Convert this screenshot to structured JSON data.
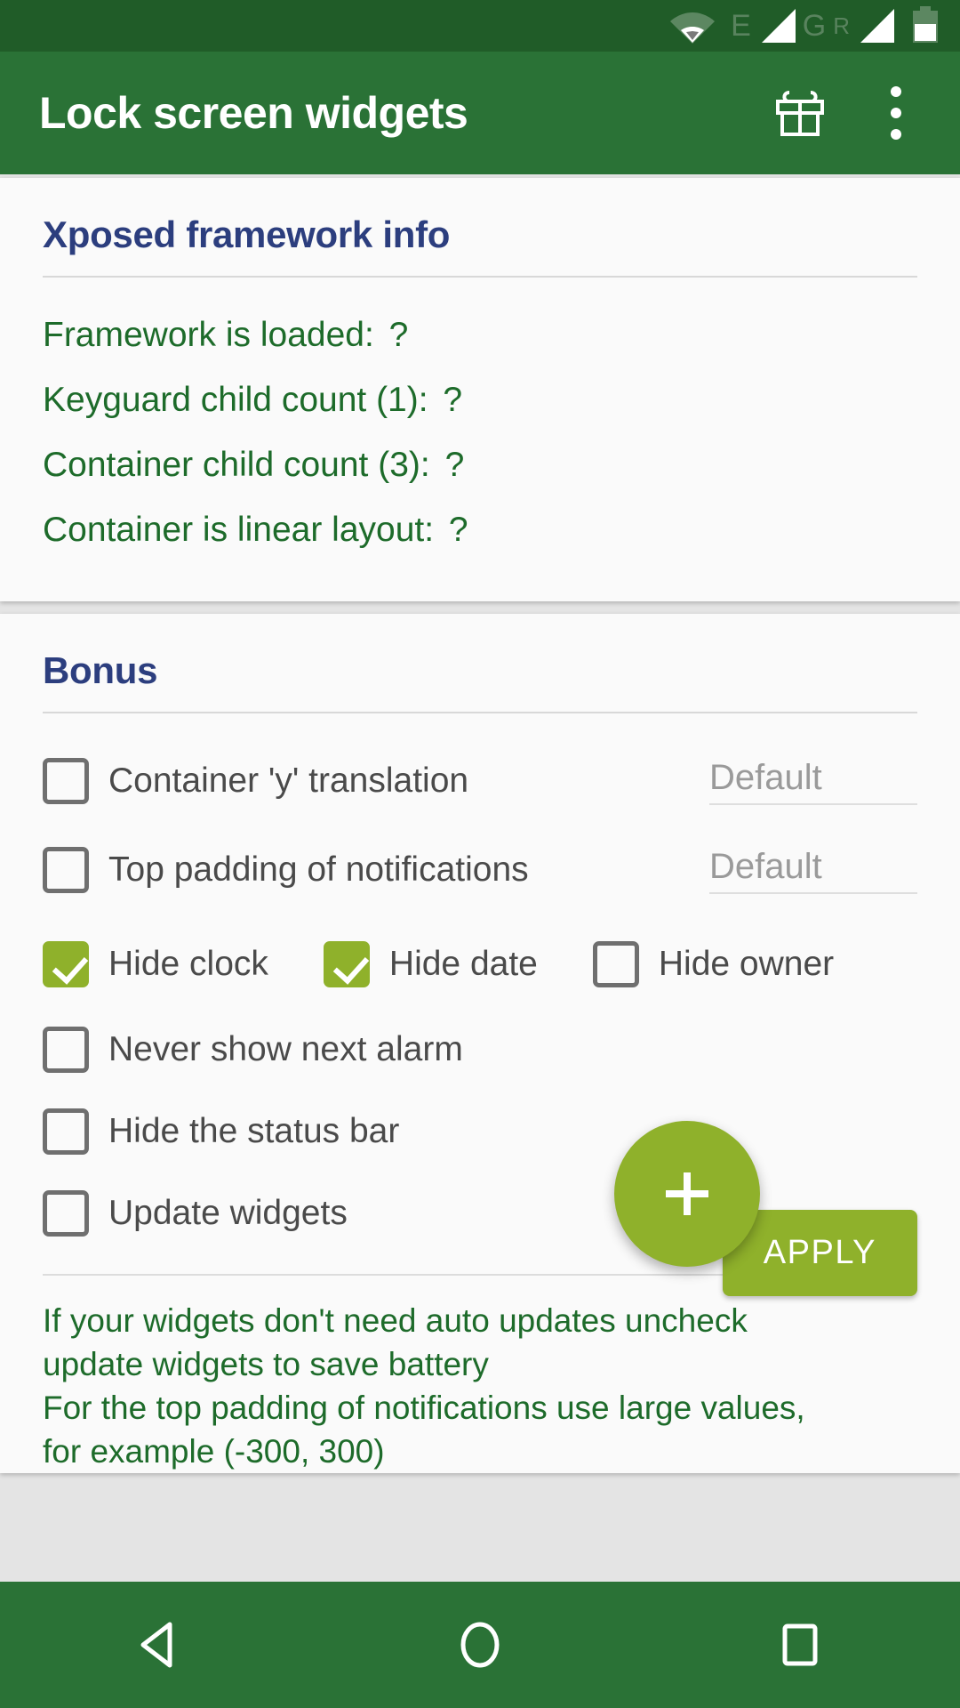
{
  "status_bar": {
    "icons": [
      {
        "name": "wifi-icon",
        "label": "wifi"
      },
      {
        "name": "network-type-edge-icon",
        "label": "E"
      },
      {
        "name": "signal-strength-sim1-icon",
        "label": "signal"
      },
      {
        "name": "network-type-gprs-icon",
        "label": "G"
      },
      {
        "name": "roaming-indicator-icon",
        "label": "R"
      },
      {
        "name": "signal-strength-sim2-icon",
        "label": "signal"
      },
      {
        "name": "battery-icon",
        "label": "battery"
      }
    ],
    "edge_label": "E",
    "gprs_label": "G",
    "roaming_label": "R"
  },
  "app_bar": {
    "title": "Lock screen widgets",
    "gift_action": "gift-icon",
    "overflow_action": "more-options-icon"
  },
  "xposed_card": {
    "title": "Xposed framework info",
    "rows": [
      {
        "label": "Framework is loaded:",
        "value": "?"
      },
      {
        "label": "Keyguard child count (1):",
        "value": "?"
      },
      {
        "label": "Container child count (3):",
        "value": "?"
      },
      {
        "label": "Container is linear layout:",
        "value": "?"
      }
    ]
  },
  "bonus_card": {
    "title": "Bonus",
    "container_y_translation": {
      "label": "Container 'y' translation",
      "checked": false,
      "field_value": "",
      "field_placeholder": "Default"
    },
    "top_padding_notifications": {
      "label": "Top padding of notifications",
      "checked": false,
      "field_value": "",
      "field_placeholder": "Default"
    },
    "hide_clock": {
      "label": "Hide clock",
      "checked": true
    },
    "hide_date": {
      "label": "Hide date",
      "checked": true
    },
    "hide_owner": {
      "label": "Hide owner",
      "checked": false
    },
    "never_show_next_alarm": {
      "label": "Never show next alarm",
      "checked": false
    },
    "hide_status_bar": {
      "label": "Hide the status bar",
      "checked": false
    },
    "update_widgets": {
      "label": "Update widgets",
      "checked": false
    },
    "apply_label": "APPLY",
    "help_text": "If your widgets don't need auto updates uncheck\nupdate widgets to save battery\nFor the top padding of notifications use large values,\nfor example (-300, 300)"
  },
  "fab": {
    "name": "add-widget-fab",
    "label": "+"
  },
  "nav_bar": {
    "back": "back-button",
    "home": "home-button",
    "recents": "recents-button"
  },
  "colors": {
    "status_bar": "#205c28",
    "app_bar": "#2a7236",
    "accent_green": "#8fb12b",
    "card_title": "#2c3e7e",
    "info_text": "#1d6b2a",
    "card_bg": "#fafafa"
  }
}
